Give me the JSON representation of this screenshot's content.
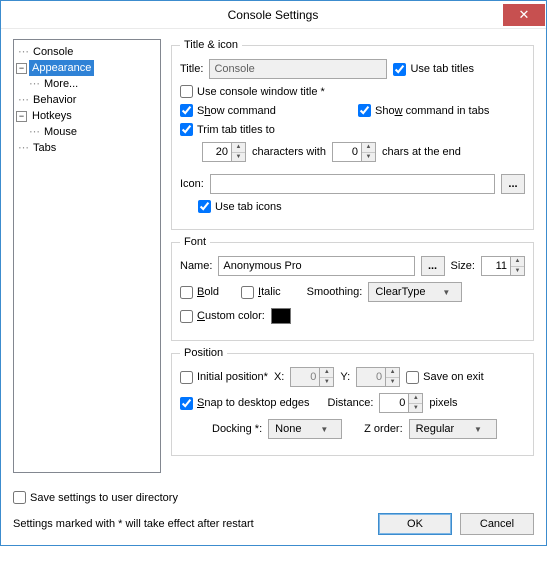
{
  "window": {
    "title": "Console Settings"
  },
  "tree": {
    "console": "Console",
    "appearance": "Appearance",
    "more": "More...",
    "behavior": "Behavior",
    "hotkeys": "Hotkeys",
    "mouse": "Mouse",
    "tabs": "Tabs",
    "exp_minus": "−",
    "selected": "appearance"
  },
  "titleicon": {
    "legend": "Title & icon",
    "title_lbl": "Title:",
    "title_val": "Console",
    "use_tab_titles": "Use tab titles",
    "use_console_window_title": "Use console window title *",
    "show_command_pre": "S",
    "show_command_u": "h",
    "show_command_post": "ow command",
    "show_command_tabs_pre": "Sho",
    "show_command_tabs_u": "w",
    "show_command_tabs_post": " command in tabs",
    "trim_tab_titles": "Trim tab titles to",
    "chars_with": "characters with",
    "chars_end": "chars at the end",
    "trim_val": "20",
    "end_val": "0",
    "icon_lbl": "Icon:",
    "browse": "...",
    "use_tab_icons": "Use tab icons"
  },
  "font": {
    "legend": "Font",
    "name_lbl": "Name:",
    "name_val": "Anonymous Pro",
    "browse": "...",
    "size_lbl": "Size:",
    "size_val": "11",
    "bold_u": "B",
    "bold_post": "old",
    "italic_u": "I",
    "italic_post": "talic",
    "smoothing_lbl": "Smoothing:",
    "smoothing_val": "ClearType",
    "custom_color_u": "C",
    "custom_color_post": "ustom color:",
    "swatch_color": "#000000"
  },
  "position": {
    "legend": "Position",
    "initial_position": "Initial position*",
    "x_lbl": "X:",
    "x_val": "0",
    "y_lbl": "Y:",
    "y_val": "0",
    "save_on_exit": "Save on exit",
    "snap_u": "S",
    "snap_post": "nap to desktop edges",
    "distance_lbl": "Distance:",
    "distance_val": "0",
    "pixels": "pixels",
    "docking_lbl": "Docking *:",
    "docking_val": "None",
    "zorder_lbl": "Z order:",
    "zorder_val": "Regular"
  },
  "footer": {
    "save_settings": "Save settings to user directory",
    "note": "Settings marked with * will take effect after restart",
    "ok": "OK",
    "cancel": "Cancel"
  }
}
